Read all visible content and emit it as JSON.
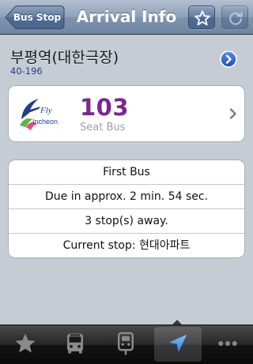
{
  "navbar": {
    "back_label": "Bus Stop",
    "title": "Arrival Info",
    "favorite_icon": "star-icon",
    "refresh_icon": "refresh-icon"
  },
  "stop": {
    "name": "부평역(대한극장)",
    "code": "40-196",
    "detail_icon": "chevron-right-circle-icon"
  },
  "route": {
    "logo_text": "Incheon",
    "logo_brand": "Fly",
    "number": "103",
    "type": "Seat Bus",
    "number_color": "#7b2790"
  },
  "arrival": {
    "rows": [
      "First Bus",
      "Due in approx. 2 min. 54 sec.",
      "3 stop(s) away.",
      "Current stop: 현대아파트"
    ]
  },
  "tabbar": {
    "tabs": [
      {
        "icon": "star-icon"
      },
      {
        "icon": "bus-icon"
      },
      {
        "icon": "bus-stop-icon"
      },
      {
        "icon": "location-arrow-icon",
        "active": true
      },
      {
        "icon": "more-icon"
      }
    ]
  }
}
